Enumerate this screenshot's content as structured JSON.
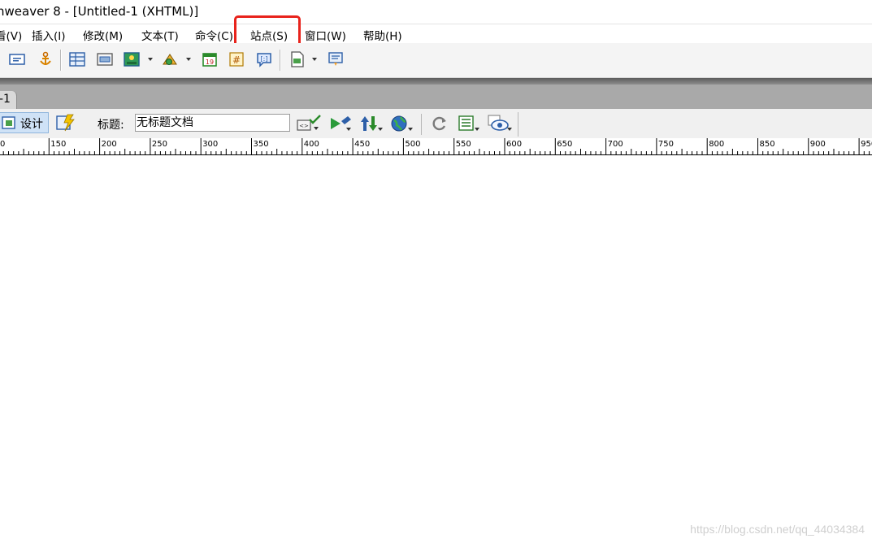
{
  "window": {
    "title": "nweaver 8 - [Untitled-1 (XHTML)]"
  },
  "menu": {
    "items": [
      "看(V)",
      "插入(I)",
      "修改(M)",
      "文本(T)",
      "命令(C)",
      "站点(S)",
      "窗口(W)",
      "帮助(H)"
    ],
    "highlighted": "站点(S)",
    "highlight_color": "#e8231c"
  },
  "toolbar": {
    "icons": [
      "email-link-icon",
      "named-anchor-icon",
      "table-icon",
      "layer-icon",
      "image-icon",
      "media-icon",
      "date-icon",
      "comment-icon",
      "tag-chooser-icon",
      "template-icon",
      "tag-chooser-2-icon"
    ]
  },
  "tabs": {
    "document_tab": "-1"
  },
  "document_toolbar": {
    "design_label": "设计",
    "title_label": "标题:",
    "title_value": "无标题文档"
  },
  "ruler": {
    "labels": [
      "0",
      "150",
      "200",
      "250",
      "300",
      "350",
      "400",
      "450",
      "500",
      "550",
      "600",
      "650",
      "700",
      "750",
      "800",
      "850",
      "900",
      "950"
    ]
  },
  "watermark": "https://blog.csdn.net/qq_44034384"
}
